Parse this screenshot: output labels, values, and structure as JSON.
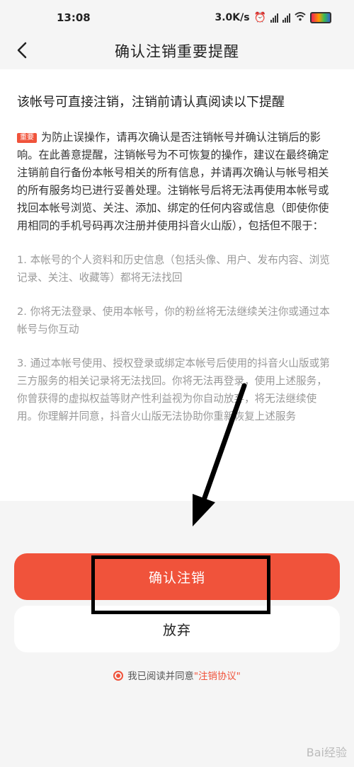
{
  "status": {
    "time": "13:08",
    "speed": "3.0K/s",
    "icons": [
      "alarm-icon",
      "signal-hd-icon",
      "signal-hd-icon",
      "wifi-icon",
      "battery-icon"
    ]
  },
  "nav": {
    "back_icon": "back-chevron-icon",
    "title": "确认注销重要提醒"
  },
  "content": {
    "lead": "该帐号可直接注销，注销前请认真阅读以下提醒",
    "tag": "重要",
    "warning": "为防止误操作，请再次确认是否注销帐号并确认注销后的影响。在此善意提醒，注销帐号为不可恢复的操作，建议在最终确定注销前自行备份本帐号相关的所有信息，并请再次确认与帐号相关的所有服务均已进行妥善处理。注销帐号后将无法再使用本帐号或找回本帐号浏览、关注、添加、绑定的任何内容或信息（即使你使用相同的手机号码再次注册并使用抖音火山版），包括但不限于：",
    "items": [
      "1. 本帐号的个人资料和历史信息（包括头像、用户、发布内容、浏览记录、关注、收藏等）都将无法找回",
      "2. 你将无法登录、使用本帐号，你的粉丝将无法继续关注你或通过本帐号与你互动",
      "3. 通过本帐号使用、授权登录或绑定本帐号后使用的抖音火山版或第三方服务的相关记录将无法找回。你将无法再登录，使用上述服务，你曾获得的虚拟权益等财产性利益视为你自动放弃，将无法继续使用。你理解并同意，抖音火山版无法协助你重新恢复上述服务"
    ]
  },
  "actions": {
    "confirm_label": "确认注销",
    "cancel_label": "放弃",
    "agree_text": "我已阅读并同意",
    "agree_link": "\"注销协议\""
  },
  "watermark": "Bai经验",
  "colors": {
    "accent": "#f0533b",
    "background": "#f5f5f5"
  }
}
